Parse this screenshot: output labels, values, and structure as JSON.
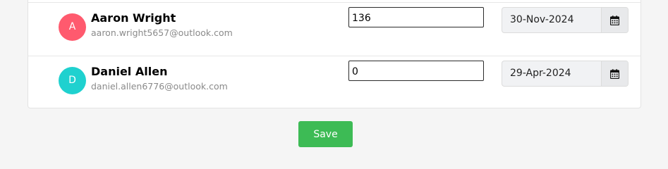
{
  "rows": [
    {
      "avatar_letter": "A",
      "avatar_color": "#ff5a6e",
      "name": "Aaron Wright",
      "email": "aaron.wright5657@outlook.com",
      "quantity": "136",
      "date": "30-Nov-2024"
    },
    {
      "avatar_letter": "D",
      "avatar_color": "#1fd1cf",
      "name": "Daniel Allen",
      "email": "daniel.allen6776@outlook.com",
      "quantity": "0",
      "date": "29-Apr-2024"
    }
  ],
  "calendar_icon": "calendar-icon",
  "save_label": "Save",
  "colors": {
    "save_button": "#3dbb55",
    "background": "#f5f5f5"
  }
}
